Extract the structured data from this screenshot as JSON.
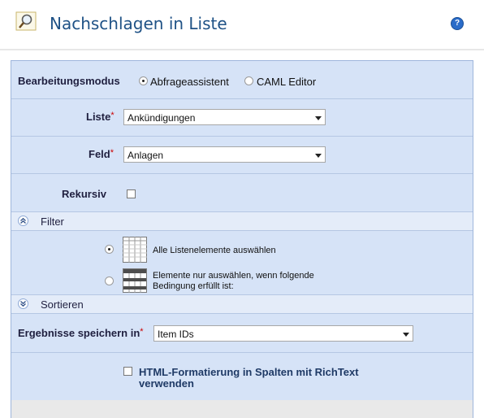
{
  "header": {
    "title": "Nachschlagen in Liste",
    "help_icon": "help-icon",
    "title_icon": "magnifier-icon"
  },
  "form": {
    "mode": {
      "label": "Bearbeitungsmodus",
      "options": [
        "Abfrageassistent",
        "CAML Editor"
      ],
      "selected": "Abfrageassistent"
    },
    "list": {
      "label": "Liste",
      "required_marker": "*",
      "value": "Ankündigungen"
    },
    "field": {
      "label": "Feld",
      "required_marker": "*",
      "value": "Anlagen"
    },
    "recursive": {
      "label": "Rekursiv",
      "checked": false
    },
    "filter": {
      "label": "Filter",
      "expanded": true,
      "option_all": "Alle Listenelemente auswählen",
      "option_condition_line1": "Elemente nur auswählen, wenn folgende",
      "option_condition_line2": "Bedingung erfüllt ist:",
      "selected": "all"
    },
    "sort": {
      "label": "Sortieren",
      "expanded": false
    },
    "store_results": {
      "label": "Ergebnisse speichern in",
      "required_marker": "*",
      "value": "Item IDs"
    },
    "html_format": {
      "label_line1": "HTML-Formatierung in Spalten mit RichText",
      "label_line2": "verwenden",
      "checked": false
    }
  },
  "colors": {
    "title": "#1f5286",
    "panel_bg": "#d6e3f7",
    "section_bg": "#e4ecf9",
    "required": "#cc0000"
  }
}
